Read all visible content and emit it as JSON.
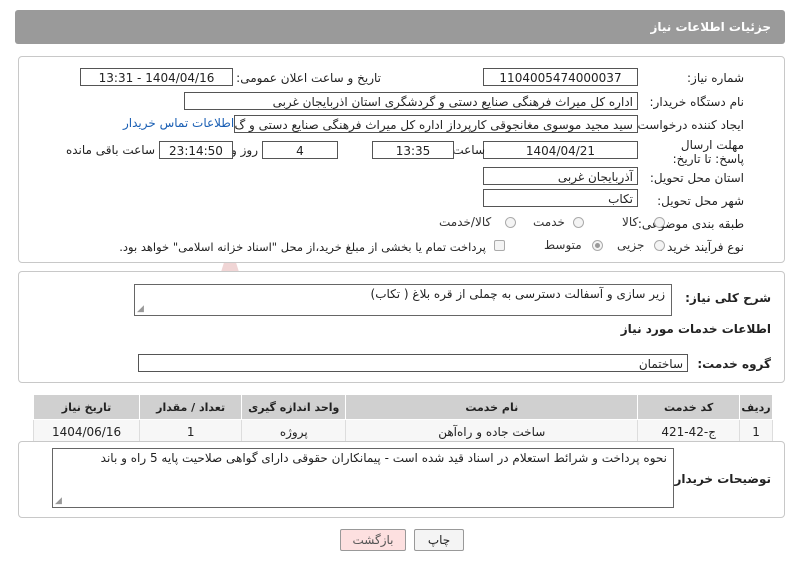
{
  "header": {
    "title": "جزئیات اطلاعات نیاز"
  },
  "watermark": {
    "text": "AriaTender.net"
  },
  "fields": {
    "need_number_label": "شماره نیاز:",
    "need_number": "1104005474000037",
    "announce_label": "تاریخ و ساعت اعلان عمومی:",
    "announce_value": "1404/04/16 - 13:31",
    "buyer_org_label": "نام دستگاه خریدار:",
    "buyer_org": "اداره کل میراث فرهنگی  صنایع دستی و گردشگری استان اذربایجان غربی",
    "creator_label": "ایجاد کننده درخواست:",
    "creator": "سید مجید موسوی مغانجوقی کارپرداز اداره کل میراث فرهنگی  صنایع دستی و گ",
    "contact_link": "اطلاعات تماس خریدار",
    "deadline_label": "مهلت ارسال پاسخ: تا تاریخ:",
    "deadline_date": "1404/04/21",
    "time_label": "ساعت",
    "deadline_time": "13:35",
    "days_value": "4",
    "days_label": "روز و",
    "remaining_time": "23:14:50",
    "remaining_label": "ساعت باقی مانده",
    "province_label": "استان محل تحویل:",
    "province": "آذربایجان غربی",
    "city_label": "شهر محل تحویل:",
    "city": "تکاب",
    "category_label": "طبقه بندی موضوعی:",
    "category_options": [
      "کالا",
      "خدمت",
      "کالا/خدمت"
    ],
    "process_label": "نوع فرآیند خرید :",
    "process_options": [
      "جزیی",
      "متوسط"
    ],
    "payment_note": "پرداخت تمام یا بخشی از مبلغ خرید،از محل \"اسناد خزانه اسلامی\" خواهد بود."
  },
  "summary": {
    "label": "شرح کلی نیاز:",
    "text": "زیر سازی و آسفالت دسترسی به چملی از قره بلاغ ( تکاب)"
  },
  "services": {
    "section_title": "اطلاعات خدمات مورد نیاز",
    "group_label": "گروه خدمت:",
    "group_value": "ساختمان",
    "columns": [
      "ردیف",
      "کد خدمت",
      "نام خدمت",
      "واحد اندازه گیری",
      "تعداد / مقدار",
      "تاریخ نیاز"
    ],
    "rows": [
      [
        "1",
        "ج-42-421",
        "ساخت جاده و راه‌آهن",
        "پروژه",
        "1",
        "1404/06/16"
      ]
    ]
  },
  "buyer_notes": {
    "label": "توضیحات خریدار:",
    "text": "نحوه پرداخت و شرائط استعلام در اسناد قید شده است - پیمانکاران حقوقی دارای گواهی صلاحیت پایه 5 راه و باند"
  },
  "buttons": {
    "print": "چاپ",
    "back": "بازگشت"
  }
}
